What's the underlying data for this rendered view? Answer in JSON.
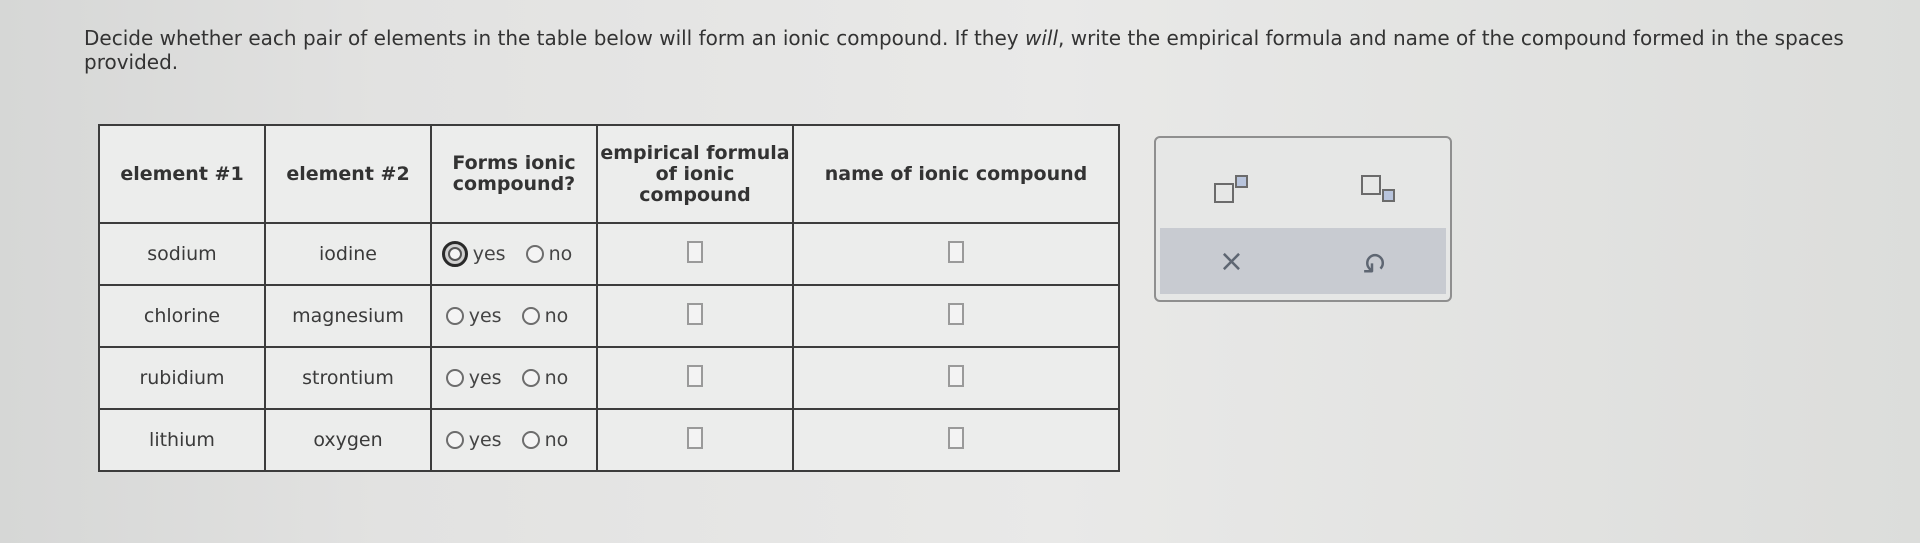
{
  "instructions": {
    "before_italic": "Decide whether each pair of elements in the table below will form an ionic compound. If they ",
    "italic": "will",
    "after_italic": ", write the empirical formula and name of the compound formed in the spaces provided."
  },
  "table": {
    "headers": {
      "element1": "element #1",
      "element2": "element #2",
      "forms": "Forms ionic compound?",
      "formula": "empirical formula of ionic compound",
      "name": "name of ionic compound"
    },
    "rows": [
      {
        "element1": "sodium",
        "element2": "iodine",
        "yes": "yes",
        "no": "no"
      },
      {
        "element1": "chlorine",
        "element2": "magnesium",
        "yes": "yes",
        "no": "no"
      },
      {
        "element1": "rubidium",
        "element2": "strontium",
        "yes": "yes",
        "no": "no"
      },
      {
        "element1": "lithium",
        "element2": "oxygen",
        "yes": "yes",
        "no": "no"
      }
    ]
  },
  "toolbar": {
    "superscript_icon": "superscript-icon",
    "subscript_icon": "subscript-icon",
    "clear_glyph": "×",
    "undo_glyph": "↺"
  },
  "colors": {
    "toolbar_bottom": "#c8cbd1",
    "icon": "#5e6672"
  }
}
